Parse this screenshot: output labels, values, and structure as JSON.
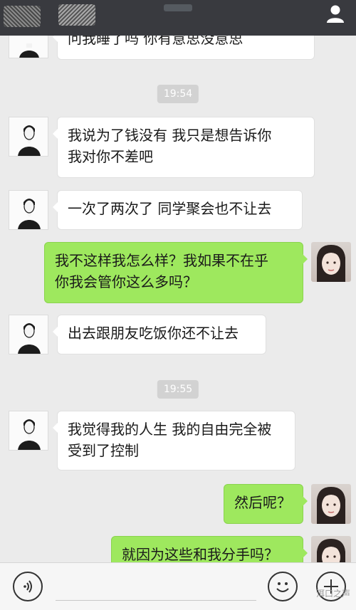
{
  "header": {
    "blurred": true
  },
  "timestamps": [
    "19:54",
    "19:55"
  ],
  "messages": [
    {
      "side": "left",
      "text": "问我睡了吗 你有意思没意思"
    },
    {
      "side": "left",
      "text": "我说为了钱没有  我只是想告诉你\n我对你不差吧"
    },
    {
      "side": "left",
      "text": "一次了两次了 同学聚会也不让去"
    },
    {
      "side": "right",
      "text": "我不这样我怎么样？我如果不在乎\n你我会管你这么多吗？"
    },
    {
      "side": "left",
      "text": "出去跟朋友吃饭你还不让去"
    },
    {
      "side": "left",
      "text": "我觉得我的人生 我的自由完全被\n受到了控制"
    },
    {
      "side": "right",
      "text": "然后呢？"
    },
    {
      "side": "right",
      "text": "就因为这些和我分手吗？"
    }
  ],
  "input_bar": {
    "voice_icon": "voice-icon",
    "emoji_icon": "emoji-icon",
    "plus_icon": "plus-icon",
    "watermark": "洱口之声"
  },
  "colors": {
    "topbar": "#393a3f",
    "chat_bg": "#ebebeb",
    "bubble_right": "#9ee85e",
    "bubble_left": "#ffffff"
  }
}
